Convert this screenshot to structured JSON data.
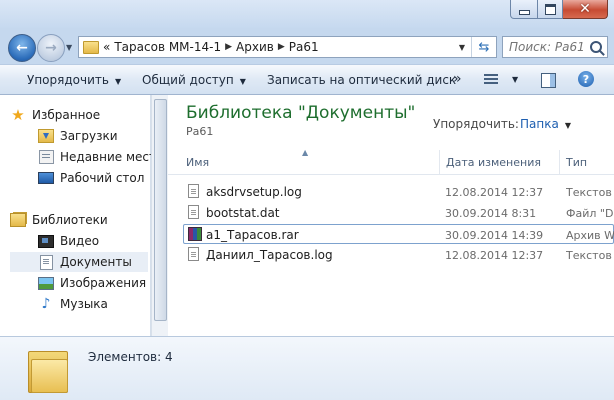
{
  "window": {
    "address_crumbs": [
      "«",
      "Тарасов ММ-14-1",
      "Архив",
      "Ра61"
    ],
    "search_placeholder": "Поиск: Ра61"
  },
  "toolbar": {
    "organize": "Упорядочить",
    "share": "Общий доступ",
    "burn": "Записать на оптический диск",
    "more": "»"
  },
  "sidebar": {
    "favorites_header": "Избранное",
    "favorites": [
      "Загрузки",
      "Недавние места",
      "Рабочий стол"
    ],
    "libraries_header": "Библиотеки",
    "libraries": [
      "Видео",
      "Документы",
      "Изображения",
      "Музыка"
    ],
    "selected": "Документы"
  },
  "content": {
    "title": "Библиотека \"Документы\"",
    "subtitle": "Ра61",
    "arrange_label": "Упорядочить:",
    "arrange_value": "Папка",
    "columns": {
      "name": "Имя",
      "date": "Дата изменения",
      "type": "Тип"
    },
    "files": [
      {
        "name": "aksdrvsetup.log",
        "date": "12.08.2014 12:37",
        "type": "Текстов",
        "icon": "text-file-icon"
      },
      {
        "name": "bootstat.dat",
        "date": "30.09.2014 8:31",
        "type": "Файл \"D",
        "icon": "text-file-icon"
      },
      {
        "name": "a1_Тарасов.rar",
        "date": "30.09.2014 14:39",
        "type": "Архив W",
        "icon": "rar-archive-icon"
      },
      {
        "name": "Даниил_Тарасов.log",
        "date": "12.08.2014 12:37",
        "type": "Текстов",
        "icon": "text-file-icon"
      }
    ]
  },
  "details": {
    "items_count": "Элементов: 4"
  }
}
